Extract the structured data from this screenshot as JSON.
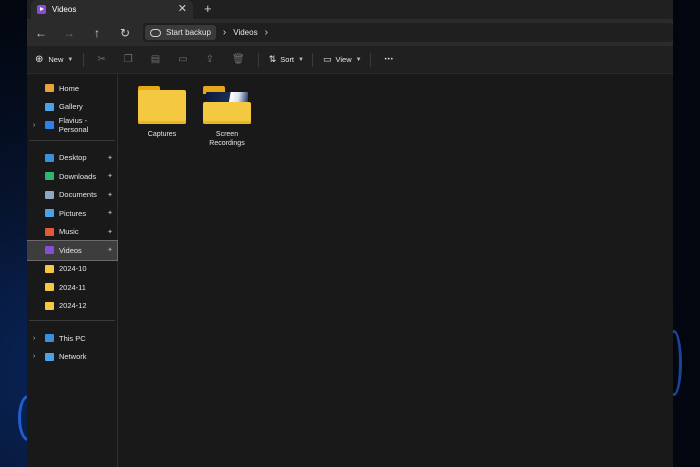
{
  "tab": {
    "title": "Videos",
    "close_glyph": "✕",
    "new_glyph": "+",
    "icon": "videos-folder-icon"
  },
  "nav": {
    "back": "←",
    "forward": "→",
    "up": "↑",
    "refresh": "↻"
  },
  "breadcrumb": {
    "items": [
      "Start backup",
      "Videos"
    ],
    "sep": "›"
  },
  "toolbar": {
    "new_label": "New",
    "sort_label": "Sort",
    "view_label": "View",
    "more": "•••"
  },
  "sidebar": {
    "top": [
      {
        "label": "Home",
        "icon": "home-icon",
        "color": "#e9a23b"
      },
      {
        "label": "Gallery",
        "icon": "gallery-icon",
        "color": "#4aa3e8"
      },
      {
        "label": "Flavius - Personal",
        "icon": "onedrive-icon",
        "color": "#2f80ed",
        "expandable": true
      }
    ],
    "pinned": [
      {
        "label": "Desktop",
        "icon": "desktop-icon",
        "color": "#3b8fe0"
      },
      {
        "label": "Downloads",
        "icon": "downloads-icon",
        "color": "#2bb673"
      },
      {
        "label": "Documents",
        "icon": "documents-icon",
        "color": "#8fa6c2"
      },
      {
        "label": "Pictures",
        "icon": "pictures-icon",
        "color": "#4aa3e8"
      },
      {
        "label": "Music",
        "icon": "music-icon",
        "color": "#e05a3a"
      },
      {
        "label": "Videos",
        "icon": "videos-icon",
        "color": "#8a4cd8",
        "selected": true
      },
      {
        "label": "2024-10",
        "icon": "folder-icon",
        "color": "#f5c842"
      },
      {
        "label": "2024-11",
        "icon": "folder-icon",
        "color": "#f5c842"
      },
      {
        "label": "2024-12",
        "icon": "folder-icon",
        "color": "#f5c842"
      }
    ],
    "bottom": [
      {
        "label": "This PC",
        "icon": "this-pc-icon",
        "color": "#3b8fe0",
        "expandable": true
      },
      {
        "label": "Network",
        "icon": "network-icon",
        "color": "#4aa3e8",
        "expandable": true
      }
    ],
    "pin_glyph": "📌"
  },
  "folders": [
    {
      "label": "Captures",
      "media": false
    },
    {
      "label": "Screen\nRecordings",
      "media": true
    }
  ]
}
